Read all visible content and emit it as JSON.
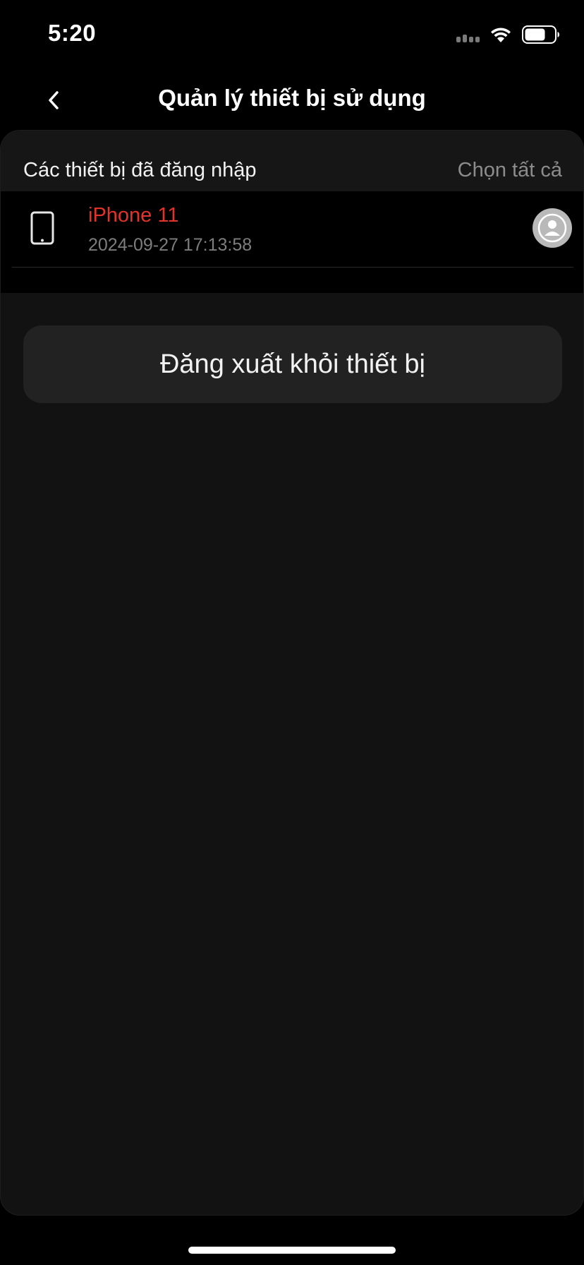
{
  "status_bar": {
    "time": "5:20",
    "icons": [
      "signal-icon",
      "wifi-icon",
      "battery-icon"
    ]
  },
  "nav": {
    "title": "Quản lý thiết bị sử dụng",
    "back_icon": "chevron-left-icon"
  },
  "section": {
    "title": "Các thiết bị đã đăng nhập",
    "select_all_label": "Chọn tất cả"
  },
  "devices": [
    {
      "name": "iPhone 11",
      "last_login": "2024-09-27 17:13:58",
      "icon": "phone-icon",
      "selected": false
    }
  ],
  "actions": {
    "logout_label": "Đăng xuất khỏi thiết bị"
  },
  "colors": {
    "background": "#000000",
    "panel": "#121212",
    "accent_red": "#e0342b",
    "muted_text": "#7d7d7d",
    "button_bg": "#222222"
  }
}
